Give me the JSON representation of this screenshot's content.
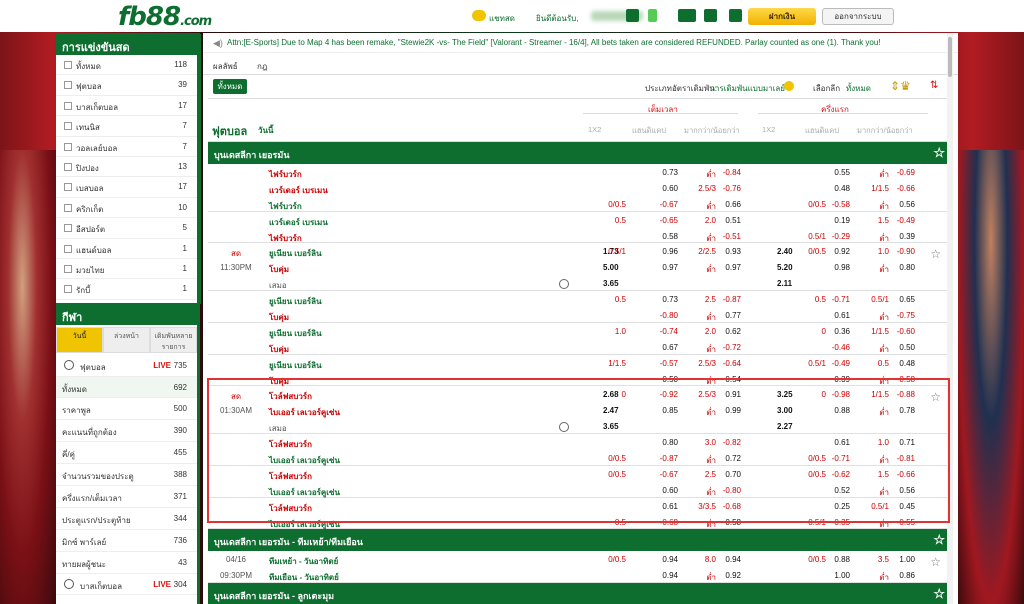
{
  "header": {
    "logo": "fb88",
    "logo_suffix": ".com",
    "chat_label": "แชทสด",
    "welcome_label": "ยินดีต้อนรับ,",
    "deposit_label": "ฝากเงิน",
    "logout_label": "ออกจากระบบ"
  },
  "sidebar": {
    "live_title": "การแข่งขันสด",
    "categories": [
      {
        "name": "ทั้งหมด",
        "count": "118"
      },
      {
        "name": "ฟุตบอล",
        "count": "39"
      },
      {
        "name": "บาสเก็ตบอล",
        "count": "17"
      },
      {
        "name": "เทนนิส",
        "count": "7"
      },
      {
        "name": "วอลเลย์บอล",
        "count": "7"
      },
      {
        "name": "ปิงปอง",
        "count": "13"
      },
      {
        "name": "เบสบอล",
        "count": "17"
      },
      {
        "name": "คริกเก็ต",
        "count": "10"
      },
      {
        "name": "อีสปอร์ต",
        "count": "5"
      },
      {
        "name": "แฮนด์บอล",
        "count": "1"
      },
      {
        "name": "มวยไทย",
        "count": "1"
      },
      {
        "name": "รักบี้",
        "count": "1"
      }
    ],
    "sports_title": "กีฬา",
    "tabs": [
      "วันนี้",
      "ล่วงหน้า",
      "เดิมพันหลายรายการ"
    ],
    "sport_rows": [
      {
        "name": "ฟุตบอล",
        "live": "LIVE",
        "count": "735",
        "kind": "sport"
      },
      {
        "name": "ทั้งหมด",
        "count": "692",
        "kind": "sel"
      },
      {
        "name": "ราคาพูล",
        "count": "500"
      },
      {
        "name": "คะแนนที่ถูกต้อง",
        "count": "390"
      },
      {
        "name": "คี่/คู่",
        "count": "455"
      },
      {
        "name": "จำนวนรวมของประตู",
        "count": "388"
      },
      {
        "name": "ครึ่งแรก/เต็มเวลา",
        "count": "371"
      },
      {
        "name": "ประตูแรก/ประตูท้าย",
        "count": "344"
      },
      {
        "name": "มิกซ์ พาร์เลย์",
        "count": "736"
      },
      {
        "name": "ทายผลผู้ชนะ",
        "count": "43"
      },
      {
        "name": "บาสเก็ตบอล",
        "live": "LIVE",
        "count": "304",
        "kind": "sport"
      }
    ]
  },
  "main": {
    "notice": "Attn:[E-Sports] Due to Map 4 has been remake, \"Stewie2K -vs- The Field\" [Valorant - Streamer - 16/4], All bets taken are considered REFUNDED. Parlay counted as one (1). Thank you!",
    "subtabs": [
      "ผลลัพธ์",
      "กฎ"
    ],
    "filter": {
      "all_label": "ทั้งหมด",
      "odds_type_label": "ประเภทอัตราเดิมพัน:",
      "odds_type_value": "การเดิมพันแบบมาเลย์",
      "select_label": "เลือกลีก",
      "select_value": "ทั้งหมด"
    },
    "header": {
      "sport": "ฟุตบอล",
      "day": "วันนี้",
      "ft_label": "เต็มเวลา",
      "ht_label": "ครึ่งแรก",
      "cols": [
        "1X2",
        "แฮนดิแคป",
        "มากกว่า/น้อยกว่า",
        "1X2",
        "แฮนดิแคป",
        "มากกว่า/น้อยกว่า"
      ]
    },
    "leagues": [
      {
        "name": "บุนเดสลีกา เยอรมัน",
        "rows": [
          {
            "home": "ไฟร์บวร์ก",
            "hc_line": "",
            "hc": "0.73",
            "ou_line": "ต่ำ",
            "ou": "-0.84",
            "ht_hc": "0.55",
            "ht_ou_line": "ต่ำ",
            "ht_ou": "-0.69",
            "homec": "r"
          },
          {
            "home": "แวร์เดอร์ เบรเมน",
            "hc": "0.60",
            "ou_line": "2.5/3",
            "ou": "-0.76",
            "ht_hc": "0.48",
            "ht_ou_line": "1/1.5",
            "ht_ou": "-0.66",
            "homec": "r"
          },
          {
            "home": "ไฟร์บวร์ก",
            "hc_line": "0/0.5",
            "hc": "-0.67",
            "ou_line": "ต่ำ",
            "ou": "0.66",
            "ht_hc_line": "0/0.5",
            "ht_hc": "-0.58",
            "ht_ou_line": "ต่ำ",
            "ht_ou": "0.56",
            "homec": "g",
            "sep": true
          },
          {
            "home": "แวร์เดอร์ เบรเมน",
            "hc_line": "0.5",
            "hc": "-0.65",
            "ou_line": "2.0",
            "ou": "0.51",
            "ht_hc": "0.19",
            "ht_ou_line": "1.5",
            "ht_ou": "-0.49",
            "homec": "g"
          },
          {
            "home": "ไฟร์บวร์ก",
            "hc": "0.58",
            "ou_line": "ต่ำ",
            "ou": "-0.51",
            "ht_hc_line": "0.5/1",
            "ht_hc": "-0.29",
            "ht_ou_line": "ต่ำ",
            "ht_ou": "0.39",
            "homec": "r",
            "sep": true
          },
          {
            "home": "ยูเนียน เบอร์ลิน",
            "ft1x2": "1.73",
            "hc_line": "0.5/1",
            "hc": "0.96",
            "ou_line": "2/2.5",
            "ou": "0.93",
            "ht1x2": "2.40",
            "ht_hc_line": "0/0.5",
            "ht_hc": "0.92",
            "ht_ou_line": "1.0",
            "ht_ou": "-0.90",
            "homec": "g",
            "time": "สด",
            "star": true
          },
          {
            "home": "โบคุ่ม",
            "ft1x2": "5.00",
            "hc": "0.97",
            "ou_line": "ต่ำ",
            "ou": "0.97",
            "ht1x2": "5.20",
            "ht_hc": "0.98",
            "ht_ou_line": "ต่ำ",
            "ht_ou": "0.80",
            "homec": "r",
            "time": "11:30PM"
          },
          {
            "home": "เสมอ",
            "ft1x2": "3.65",
            "ht1x2": "2.11",
            "homec": "d",
            "stat": true,
            "sep": true
          },
          {
            "home": "ยูเนียน เบอร์ลิน",
            "hc_line": "0.5",
            "hc": "0.73",
            "ou_line": "2.5",
            "ou": "-0.87",
            "ht_hc_line": "0.5",
            "ht_hc": "-0.71",
            "ht_ou_line": "0.5/1",
            "ht_ou": "0.65",
            "homec": "g"
          },
          {
            "home": "โบคุ่ม",
            "hc": "-0.80",
            "ou_line": "ต่ำ",
            "ou": "0.77",
            "ht_hc": "0.61",
            "ht_ou_line": "ต่ำ",
            "ht_ou": "-0.75",
            "homec": "r",
            "sep": true
          },
          {
            "home": "ยูเนียน เบอร์ลิน",
            "hc_line": "1.0",
            "hc": "-0.74",
            "ou_line": "2.0",
            "ou": "0.62",
            "ht_hc_line": "0",
            "ht_hc": "0.36",
            "ht_ou_line": "1/1.5",
            "ht_ou": "-0.60",
            "homec": "g"
          },
          {
            "home": "โบคุ่ม",
            "hc": "0.67",
            "ou_line": "ต่ำ",
            "ou": "-0.72",
            "ht_hc": "-0.46",
            "ht_ou_line": "ต่ำ",
            "ht_ou": "0.50",
            "homec": "r",
            "sep": true
          },
          {
            "home": "ยูเนียน เบอร์ลิน",
            "hc_line": "1/1.5",
            "hc": "-0.57",
            "ou_line": "2.5/3",
            "ou": "-0.64",
            "ht_hc_line": "0.5/1",
            "ht_hc": "-0.49",
            "ht_ou_line": "0.5",
            "ht_ou": "0.48",
            "homec": "g"
          },
          {
            "home": "โบคุ่ม",
            "hc": "0.50",
            "ou_line": "ต่ำ",
            "ou": "0.54",
            "ht_hc": "0.39",
            "ht_ou_line": "ต่ำ",
            "ht_ou": "-0.58",
            "homec": "r",
            "sep": true
          },
          {
            "home": "โวล์ฟสบวร์ก",
            "ft1x2": "2.68",
            "hc_line": "0",
            "hc": "-0.92",
            "ou_line": "2.5/3",
            "ou": "0.91",
            "ht1x2": "3.25",
            "ht_hc_line": "0",
            "ht_hc": "-0.98",
            "ht_ou_line": "1/1.5",
            "ht_ou": "-0.88",
            "homec": "r",
            "time": "สด",
            "star": true
          },
          {
            "home": "ไบเออร์ เลเวอร์คูเซ่น",
            "ft1x2": "2.47",
            "hc": "0.85",
            "ou_line": "ต่ำ",
            "ou": "0.99",
            "ht1x2": "3.00",
            "ht_hc": "0.88",
            "ht_ou_line": "ต่ำ",
            "ht_ou": "0.78",
            "homec": "r",
            "time": "01:30AM"
          },
          {
            "home": "เสมอ",
            "ft1x2": "3.65",
            "ht1x2": "2.27",
            "homec": "d",
            "stat": true,
            "sep": true
          },
          {
            "home": "โวล์ฟสบวร์ก",
            "hc": "0.80",
            "ou_line": "3.0",
            "ou": "-0.82",
            "ht_hc": "0.61",
            "ht_ou_line": "1.0",
            "ht_ou": "0.71",
            "homec": "r"
          },
          {
            "home": "ไบเออร์ เลเวอร์คูเซ่น",
            "hc_line": "0/0.5",
            "hc": "-0.87",
            "ou_line": "ต่ำ",
            "ou": "0.72",
            "ht_hc_line": "0/0.5",
            "ht_hc": "-0.71",
            "ht_ou_line": "ต่ำ",
            "ht_ou": "-0.81",
            "homec": "g",
            "sep": true
          },
          {
            "home": "โวล์ฟสบวร์ก",
            "hc_line": "0/0.5",
            "hc": "-0.67",
            "ou_line": "2.5",
            "ou": "0.70",
            "ht_hc_line": "0/0.5",
            "ht_hc": "-0.62",
            "ht_ou_line": "1.5",
            "ht_ou": "-0.66",
            "homec": "r"
          },
          {
            "home": "ไบเออร์ เลเวอร์คูเซ่น",
            "hc": "0.60",
            "ou_line": "ต่ำ",
            "ou": "-0.80",
            "ht_hc": "0.52",
            "ht_ou_line": "ต่ำ",
            "ht_ou": "0.56",
            "homec": "g",
            "sep": true
          },
          {
            "home": "โวล์ฟสบวร์ก",
            "hc": "0.61",
            "ou_line": "3/3.5",
            "ou": "-0.68",
            "ht_hc": "0.25",
            "ht_ou_line": "0.5/1",
            "ht_ou": "0.45",
            "homec": "r"
          },
          {
            "home": "ไบเออร์ เลเวอร์คูเซ่น",
            "hc_line": "0.5",
            "hc": "-0.68",
            "ou_line": "ต่ำ",
            "ou": "0.58",
            "ht_hc_line": "0.5/1",
            "ht_hc": "-0.35",
            "ht_ou_line": "ต่ำ",
            "ht_ou": "-0.55",
            "homec": "g",
            "sep": true
          }
        ]
      },
      {
        "name": "บุนเดสลีกา เยอรมัน - ทีมเหย้า/ทีมเยือน",
        "rows": [
          {
            "home": "ทีมเหย้า - วันอาทิตย์",
            "hc_line": "0/0.5",
            "hc": "0.94",
            "ou_line": "8.0",
            "ou": "0.94",
            "ht_hc_line": "0/0.5",
            "ht_hc": "0.88",
            "ht_ou_line": "3.5",
            "ht_ou": "1.00",
            "homec": "g",
            "time": "04/16",
            "star": true
          },
          {
            "home": "ทีมเยือน - วันอาทิตย์",
            "hc": "0.94",
            "ou_line": "ต่ำ",
            "ou": "0.92",
            "ht_hc": "1.00",
            "ht_ou_line": "ต่ำ",
            "ht_ou": "0.86",
            "homec": "g",
            "time": "09:30PM",
            "sep": true
          }
        ]
      },
      {
        "name": "บุนเดสลีกา เยอรมัน - ลูกเตะมุม",
        "rows": []
      }
    ]
  }
}
